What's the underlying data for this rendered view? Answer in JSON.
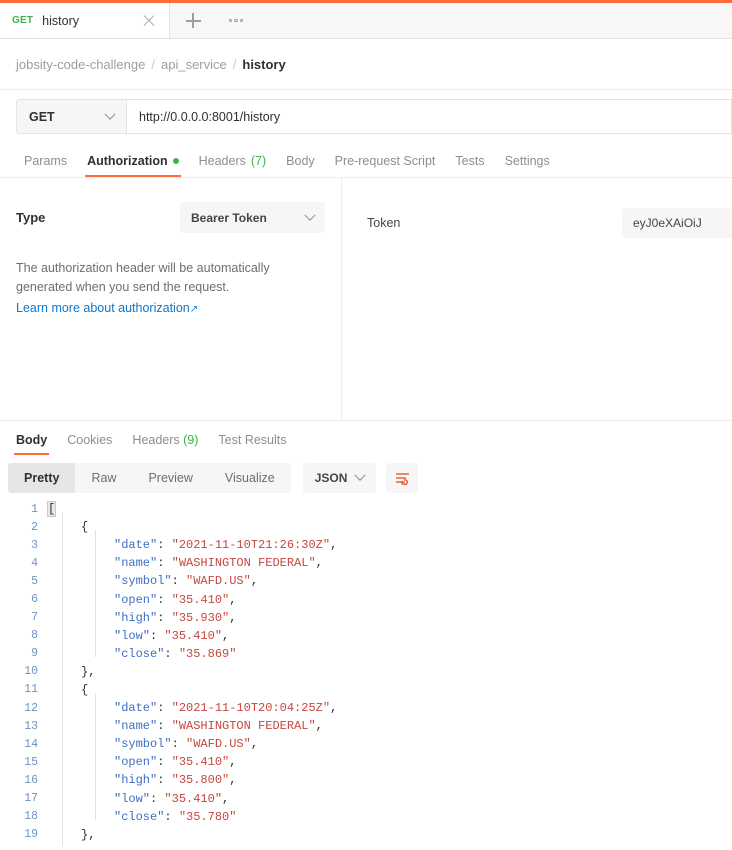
{
  "tabbar": {
    "tabs": [
      {
        "method": "GET",
        "title": "history",
        "close_icon": "close-icon"
      }
    ],
    "new_tab_icon": "plus-icon",
    "more_icon": "ellipsis-icon"
  },
  "breadcrumb": {
    "items": [
      "jobsity-code-challenge",
      "api_service",
      "history"
    ],
    "separator": "/"
  },
  "request": {
    "method": "GET",
    "method_chevron": "chevron-down-icon",
    "url": "http://0.0.0.0:8001/history",
    "tabs": [
      {
        "label": "Params",
        "active": false,
        "badge": "",
        "dot": false
      },
      {
        "label": "Authorization",
        "active": true,
        "badge": "",
        "dot": true
      },
      {
        "label": "Headers",
        "active": false,
        "badge": "(7)",
        "dot": false
      },
      {
        "label": "Body",
        "active": false,
        "badge": "",
        "dot": false
      },
      {
        "label": "Pre-request Script",
        "active": false,
        "badge": "",
        "dot": false
      },
      {
        "label": "Tests",
        "active": false,
        "badge": "",
        "dot": false
      },
      {
        "label": "Settings",
        "active": false,
        "badge": "",
        "dot": false
      }
    ]
  },
  "authorization": {
    "type_label": "Type",
    "type_value": "Bearer Token",
    "type_chevron": "chevron-down-icon",
    "note": "The authorization header will be automatically generated when you send the request.",
    "link_text": "Learn more about authorization",
    "link_arrow": "↗",
    "token_label": "Token",
    "token_value": "eyJ0eXAiOiJ"
  },
  "response": {
    "tabs": [
      {
        "label": "Body",
        "active": true,
        "badge": ""
      },
      {
        "label": "Cookies",
        "active": false,
        "badge": ""
      },
      {
        "label": "Headers",
        "active": false,
        "badge": "(9)"
      },
      {
        "label": "Test Results",
        "active": false,
        "badge": ""
      }
    ],
    "views": [
      {
        "label": "Pretty",
        "active": true
      },
      {
        "label": "Raw",
        "active": false
      },
      {
        "label": "Preview",
        "active": false
      },
      {
        "label": "Visualize",
        "active": false
      }
    ],
    "format": "JSON",
    "format_chevron": "chevron-down-icon",
    "wrap_icon": "wrap-lines-icon"
  },
  "body": {
    "lines": [
      {
        "n": 1,
        "indent": 0,
        "tokens": [
          {
            "t": "[",
            "c": "p",
            "hl": true
          }
        ]
      },
      {
        "n": 2,
        "indent": 1,
        "tokens": [
          {
            "t": "{",
            "c": "p"
          }
        ]
      },
      {
        "n": 3,
        "indent": 2,
        "tokens": [
          {
            "t": "\"date\"",
            "c": "k"
          },
          {
            "t": ": ",
            "c": "p"
          },
          {
            "t": "\"2021-11-10T21:26:30Z\"",
            "c": "s"
          },
          {
            "t": ",",
            "c": "p"
          }
        ]
      },
      {
        "n": 4,
        "indent": 2,
        "tokens": [
          {
            "t": "\"name\"",
            "c": "k"
          },
          {
            "t": ": ",
            "c": "p"
          },
          {
            "t": "\"WASHINGTON FEDERAL\"",
            "c": "s"
          },
          {
            "t": ",",
            "c": "p"
          }
        ]
      },
      {
        "n": 5,
        "indent": 2,
        "tokens": [
          {
            "t": "\"symbol\"",
            "c": "k"
          },
          {
            "t": ": ",
            "c": "p"
          },
          {
            "t": "\"WAFD.US\"",
            "c": "s"
          },
          {
            "t": ",",
            "c": "p"
          }
        ]
      },
      {
        "n": 6,
        "indent": 2,
        "tokens": [
          {
            "t": "\"open\"",
            "c": "k"
          },
          {
            "t": ": ",
            "c": "p"
          },
          {
            "t": "\"35.410\"",
            "c": "s"
          },
          {
            "t": ",",
            "c": "p"
          }
        ]
      },
      {
        "n": 7,
        "indent": 2,
        "tokens": [
          {
            "t": "\"high\"",
            "c": "k"
          },
          {
            "t": ": ",
            "c": "p"
          },
          {
            "t": "\"35.930\"",
            "c": "s"
          },
          {
            "t": ",",
            "c": "p"
          }
        ]
      },
      {
        "n": 8,
        "indent": 2,
        "tokens": [
          {
            "t": "\"low\"",
            "c": "k"
          },
          {
            "t": ": ",
            "c": "p"
          },
          {
            "t": "\"35.410\"",
            "c": "s"
          },
          {
            "t": ",",
            "c": "p"
          }
        ]
      },
      {
        "n": 9,
        "indent": 2,
        "tokens": [
          {
            "t": "\"close\"",
            "c": "k"
          },
          {
            "t": ": ",
            "c": "p"
          },
          {
            "t": "\"35.869\"",
            "c": "s"
          }
        ]
      },
      {
        "n": 10,
        "indent": 1,
        "tokens": [
          {
            "t": "},",
            "c": "p"
          }
        ]
      },
      {
        "n": 11,
        "indent": 1,
        "tokens": [
          {
            "t": "{",
            "c": "p"
          }
        ]
      },
      {
        "n": 12,
        "indent": 2,
        "tokens": [
          {
            "t": "\"date\"",
            "c": "k"
          },
          {
            "t": ": ",
            "c": "p"
          },
          {
            "t": "\"2021-11-10T20:04:25Z\"",
            "c": "s"
          },
          {
            "t": ",",
            "c": "p"
          }
        ]
      },
      {
        "n": 13,
        "indent": 2,
        "tokens": [
          {
            "t": "\"name\"",
            "c": "k"
          },
          {
            "t": ": ",
            "c": "p"
          },
          {
            "t": "\"WASHINGTON FEDERAL\"",
            "c": "s"
          },
          {
            "t": ",",
            "c": "p"
          }
        ]
      },
      {
        "n": 14,
        "indent": 2,
        "tokens": [
          {
            "t": "\"symbol\"",
            "c": "k"
          },
          {
            "t": ": ",
            "c": "p"
          },
          {
            "t": "\"WAFD.US\"",
            "c": "s"
          },
          {
            "t": ",",
            "c": "p"
          }
        ]
      },
      {
        "n": 15,
        "indent": 2,
        "tokens": [
          {
            "t": "\"open\"",
            "c": "k"
          },
          {
            "t": ": ",
            "c": "p"
          },
          {
            "t": "\"35.410\"",
            "c": "s"
          },
          {
            "t": ",",
            "c": "p"
          }
        ]
      },
      {
        "n": 16,
        "indent": 2,
        "tokens": [
          {
            "t": "\"high\"",
            "c": "k"
          },
          {
            "t": ": ",
            "c": "p"
          },
          {
            "t": "\"35.800\"",
            "c": "s"
          },
          {
            "t": ",",
            "c": "p"
          }
        ]
      },
      {
        "n": 17,
        "indent": 2,
        "tokens": [
          {
            "t": "\"low\"",
            "c": "k"
          },
          {
            "t": ": ",
            "c": "p"
          },
          {
            "t": "\"35.410\"",
            "c": "s"
          },
          {
            "t": ",",
            "c": "p"
          }
        ]
      },
      {
        "n": 18,
        "indent": 2,
        "tokens": [
          {
            "t": "\"close\"",
            "c": "k"
          },
          {
            "t": ": ",
            "c": "p"
          },
          {
            "t": "\"35.780\"",
            "c": "s"
          }
        ]
      },
      {
        "n": 19,
        "indent": 1,
        "tokens": [
          {
            "t": "},",
            "c": "p"
          }
        ]
      }
    ]
  },
  "colors": {
    "accent": "#ff6c37",
    "green": "#3eb449",
    "link": "#0b78d0",
    "json_key": "#3e6ec4",
    "json_string": "#c5483f",
    "line_number": "#6f94c4"
  }
}
